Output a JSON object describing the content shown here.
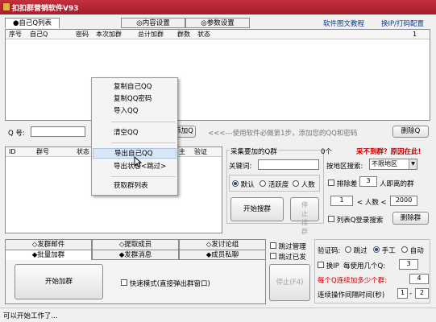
{
  "window": {
    "title": "扣扣群营销软件V93"
  },
  "top_tabs": [
    "●自己Q列表",
    "◎内容设置",
    "◎参数设置"
  ],
  "top_links": [
    "软件图文教程",
    "换IP/打码配置"
  ],
  "qq_table": {
    "headers": [
      "序号",
      "自己Q",
      "密码",
      "本次加群",
      "总计加群",
      "群数",
      "状态"
    ],
    "counter": "1"
  },
  "context_menu": {
    "items": [
      "复制自己QQ",
      "复制QQ密码",
      "导入QQ",
      "清空QQ",
      "导出自己QQ",
      "导出状态<跳过>",
      "获取群列表"
    ],
    "highlighted": 4
  },
  "qq_input": {
    "label": "Q 号:",
    "add_button": "添加Q",
    "hint": "<<<---使用软件必做第1步，添加您的QQ和密码",
    "delete_button": "删除Q"
  },
  "group_table": {
    "headers": [
      "ID",
      "群号",
      "状态",
      "主",
      "验证"
    ]
  },
  "collect": {
    "title": "采集要加的Q群",
    "count": "0个",
    "cant_find": "采不到群？原因在此!",
    "keyword_label": "关键词:",
    "region_label": "按地区搜索:",
    "region_value": "不限地区",
    "sort_options": [
      "默认",
      "活跃度",
      "人数"
    ],
    "sort_selected": 0,
    "start_button": "开始搜群",
    "stop_button": "停止搜群",
    "exclude_label": "排除差",
    "exclude_value": "3",
    "exclude_suffix": "人即离的群",
    "people_min": "1",
    "people_mid": "< 人数 <",
    "people_max": "2000",
    "list_login": "列表Q登录搜索",
    "delete_group": "删除群"
  },
  "bottom_tabs_row1": [
    "◇发群邮件",
    "◇提取成员",
    "◇发讨论组"
  ],
  "bottom_tabs_row2": [
    "◆批量加群",
    "◆发群消息",
    "◆成员私聊"
  ],
  "batch": {
    "start_button": "开始加群",
    "fast_mode": "快速模式(直接弹出群窗口)",
    "skip_manage": "跳过管理",
    "skip_sent": "跳过已发",
    "stop_button": "停止(F4)"
  },
  "verify": {
    "label": "验证码:",
    "options": [
      "跳过",
      "手工",
      "自动"
    ],
    "selected": 1,
    "switch_ip": "换IP",
    "per_label": "每使用几个Q:",
    "per_value": "3",
    "per_q_label": "每个Q连续加多少个群:",
    "per_q_value": "4",
    "interval_label": "连续操作间隔时间(秒)",
    "interval_min": "1",
    "interval_max": "2"
  },
  "status": {
    "text": "可以开始工作了..."
  }
}
